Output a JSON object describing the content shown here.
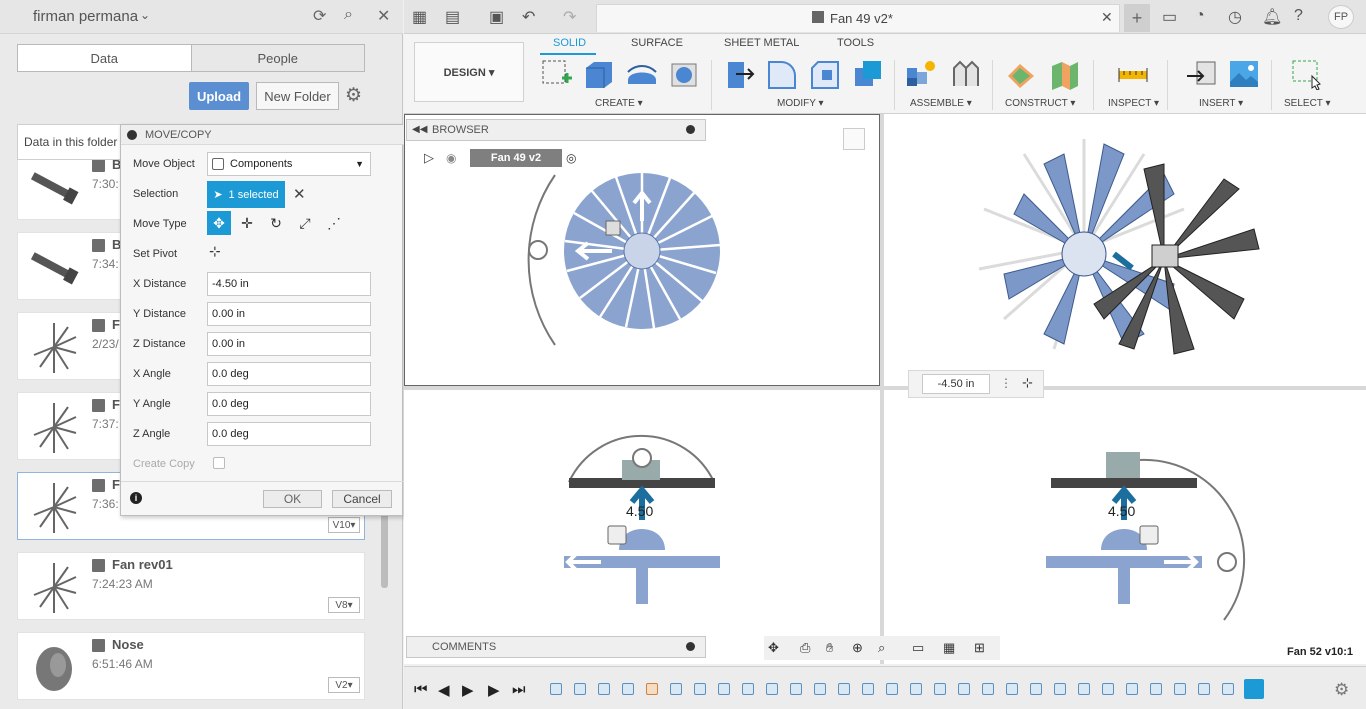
{
  "left_panel": {
    "user": "firman permana",
    "tabs": [
      "Data",
      "People"
    ],
    "upload": "Upload",
    "new_folder": "New Folder",
    "folder_label": "Data in this folder",
    "items": [
      {
        "name": "B",
        "time": "7:30:",
        "version": ""
      },
      {
        "name": "B",
        "time": "7:34:",
        "version": ""
      },
      {
        "name": "F",
        "time": "2/23/",
        "version": ""
      },
      {
        "name": "F",
        "time": "7:37:",
        "version": ""
      },
      {
        "name": "F",
        "time": "7:36:",
        "version": "V10▾"
      },
      {
        "name": "Fan rev01",
        "time": "7:24:23 AM",
        "version": "V8▾"
      },
      {
        "name": "Nose",
        "time": "6:51:46 AM",
        "version": "V2▾"
      }
    ]
  },
  "dialog": {
    "title": "MOVE/COPY",
    "move_object_label": "Move Object",
    "move_object_value": "Components",
    "selection_label": "Selection",
    "selection_value": "1 selected",
    "move_type_label": "Move Type",
    "set_pivot_label": "Set Pivot",
    "fields": [
      {
        "label": "X Distance",
        "value": "-4.50 in"
      },
      {
        "label": "Y Distance",
        "value": "0.00 in"
      },
      {
        "label": "Z Distance",
        "value": "0.00 in"
      },
      {
        "label": "X Angle",
        "value": "0.0 deg"
      },
      {
        "label": "Y Angle",
        "value": "0.0 deg"
      },
      {
        "label": "Z Angle",
        "value": "0.0 deg"
      }
    ],
    "create_copy_label": "Create Copy",
    "ok": "OK",
    "cancel": "Cancel"
  },
  "document": {
    "title": "Fan 49 v2*",
    "avatar": "FP"
  },
  "ribbon": {
    "workspace": "DESIGN ▾",
    "tabs": [
      "SOLID",
      "SURFACE",
      "SHEET METAL",
      "TOOLS"
    ],
    "groups": [
      "CREATE ▾",
      "MODIFY ▾",
      "ASSEMBLE ▾",
      "CONSTRUCT ▾",
      "INSPECT ▾",
      "INSERT ▾",
      "SELECT ▾"
    ]
  },
  "viewport": {
    "browser_label": "BROWSER",
    "root_node": "Fan 49 v2",
    "comments_label": "COMMENTS",
    "distance_value": "-4.50 in",
    "dim_label_left": "4.50",
    "dim_label_right": "4.50",
    "footer_doc": "Fan 52 v10:1"
  },
  "colors": {
    "accent": "#1b9ad6",
    "upload": "#5b8fd1",
    "part_blue": "#7b98c8",
    "part_dark": "#333333"
  }
}
